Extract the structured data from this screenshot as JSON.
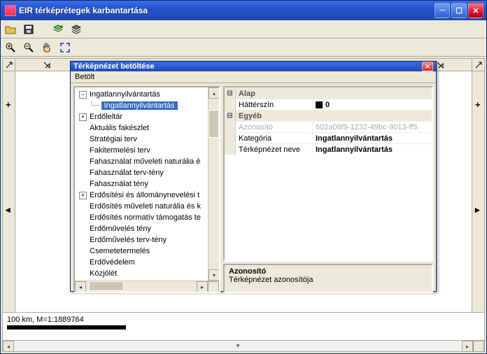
{
  "window": {
    "title": "EIR térképrétegek karbantartása"
  },
  "toolbar1": {
    "t1": "open-icon",
    "t2": "save-icon",
    "t3": "layers-add-icon",
    "t4": "layers-icon"
  },
  "toolbar2": {
    "t1": "zoom-in-icon",
    "t2": "zoom-out-icon",
    "t3": "pan-icon",
    "t4": "zoom-extents-icon"
  },
  "ruler": {
    "h1": "⇖",
    "h2": "⇖"
  },
  "status": {
    "scale": "100 km, M=1:1889764"
  },
  "dialog": {
    "title": "Térképnézet betöltése",
    "menu": "Betölt",
    "tree": {
      "root": "Ingatlannyilvántartás",
      "root_child": "Ingatlannyilvántartás",
      "n1": "Erdőleltár",
      "n2": "Aktuális fakészlet",
      "n3": "Stratégiai terv",
      "n4": "Fakitermelési terv",
      "n5": "Fahasználat műveleti naturália é",
      "n6": "Fahasználat terv-tény",
      "n7": "Fahasználat tény",
      "n8": "Erdősítési és állománynevelési t",
      "n9": "Erdősítés műveleti naturália és k",
      "n10": "Erdősítés normatív támogatás te",
      "n11": "Erdőművelés tény",
      "n12": "Erdőművelés terv-tény",
      "n13": "Csemetetermelés",
      "n14": "Erdővédelem",
      "n15": "Közjólét"
    },
    "props": {
      "cat1": "Alap",
      "p1_name": "Háttérszín",
      "p1_val": "0",
      "cat2": "Egyéb",
      "p2_name": "Azonosító",
      "p2_val": "602a08f9-1232-49bc-9013-ff5",
      "p3_name": "Kategória",
      "p3_val": "Ingatlannyilvántartás",
      "p4_name": "Térképnézet neve",
      "p4_val": "Ingatlannyilvántartás"
    },
    "help": {
      "title": "Azonosító",
      "desc": "Térképnézet azonosítója"
    }
  }
}
